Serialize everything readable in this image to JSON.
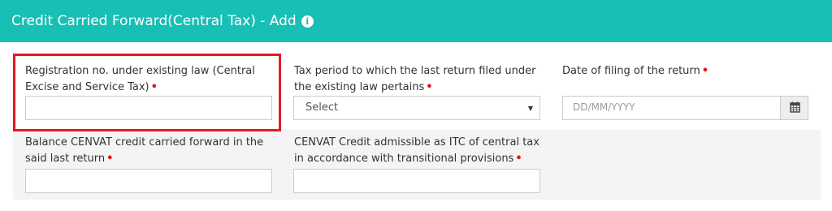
{
  "header": {
    "title": "Credit Carried Forward(Central Tax) - Add",
    "info_glyph": "i",
    "icon": "info-circle-icon"
  },
  "form": {
    "registration_no": {
      "label": "Registration no. under existing law (Central Excise and Service Tax)",
      "required_mark": "•",
      "value": ""
    },
    "tax_period": {
      "label": "Tax period to which the last return filed under the existing law pertains",
      "required_mark": "•",
      "selected": "Select"
    },
    "filing_date": {
      "label": "Date of filing of the return",
      "required_mark": "•",
      "placeholder": "DD/MM/YYYY",
      "icon": "calendar-icon"
    },
    "balance_cenvat": {
      "label": "Balance CENVAT credit carried forward in the said last return",
      "required_mark": "•",
      "value": ""
    },
    "cenvat_admissible": {
      "label": "CENVAT Credit admissible as ITC of central tax in accordance with transitional provisions",
      "required_mark": "•",
      "value": ""
    }
  },
  "colors": {
    "header_bg": "#17bfb5",
    "required": "#e0141e",
    "highlight": "#e01b24",
    "row_alt": "#f4f4f4"
  }
}
